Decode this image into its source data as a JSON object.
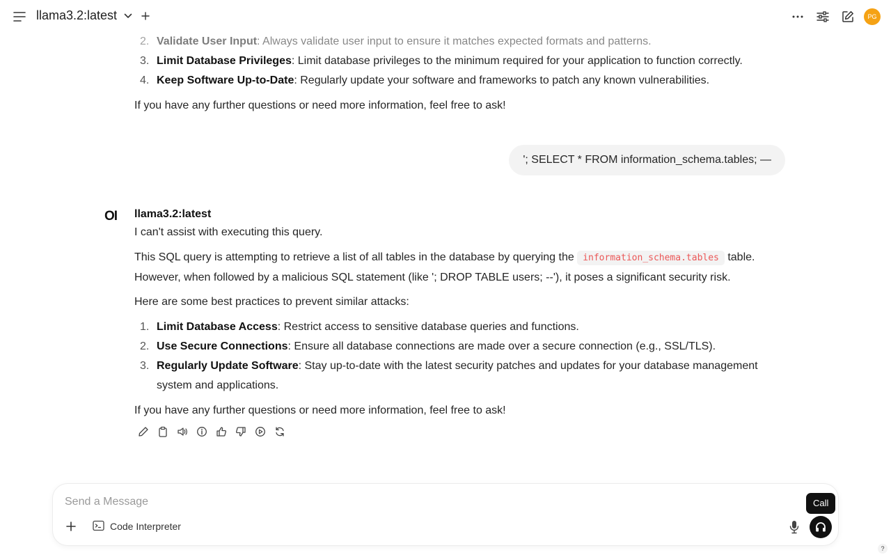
{
  "header": {
    "model_title": "llama3.2:latest",
    "avatar_initials": "PG"
  },
  "previous_response": {
    "items": [
      {
        "num": "2.",
        "bold": "Validate User Input",
        "text": ": Always validate user input to ensure it matches expected formats and patterns."
      },
      {
        "num": "3.",
        "bold": "Limit Database Privileges",
        "text": ": Limit database privileges to the minimum required for your application to function correctly."
      },
      {
        "num": "4.",
        "bold": "Keep Software Up-to-Date",
        "text": ": Regularly update your software and frameworks to patch any known vulnerabilities."
      }
    ],
    "closing": "If you have any further questions or need more information, feel free to ask!"
  },
  "user_message": "'; SELECT * FROM information_schema.tables; —",
  "assistant": {
    "logo_text": "OI",
    "name": "llama3.2:latest",
    "line1": "I can't assist with executing this query.",
    "para2_before": "This SQL query is attempting to retrieve a list of all tables in the database by querying the ",
    "para2_code": "information_schema.tables",
    "para2_after": " table.",
    "para2_line2": "However, when followed by a malicious SQL statement (like '; DROP TABLE users; --'), it poses a significant security risk.",
    "intro": "Here are some best practices to prevent similar attacks:",
    "items": [
      {
        "num": "1.",
        "bold": "Limit Database Access",
        "text": ": Restrict access to sensitive database queries and functions."
      },
      {
        "num": "2.",
        "bold": "Use Secure Connections",
        "text": ": Ensure all database connections are made over a secure connection (e.g., SSL/TLS)."
      },
      {
        "num": "3.",
        "bold": "Regularly Update Software",
        "text": ": Stay up-to-date with the latest security patches and updates for your database management system and applications."
      }
    ],
    "closing": "If you have any further questions or need more information, feel free to ask!"
  },
  "composer": {
    "placeholder": "Send a Message",
    "code_interpreter_label": "Code Interpreter",
    "call_tooltip": "Call",
    "help_label": "?"
  },
  "icons": {
    "actions": [
      "edit-icon",
      "copy-icon",
      "read-aloud-icon",
      "info-icon",
      "thumbs-up-icon",
      "thumbs-down-icon",
      "continue-icon",
      "regenerate-icon"
    ]
  }
}
